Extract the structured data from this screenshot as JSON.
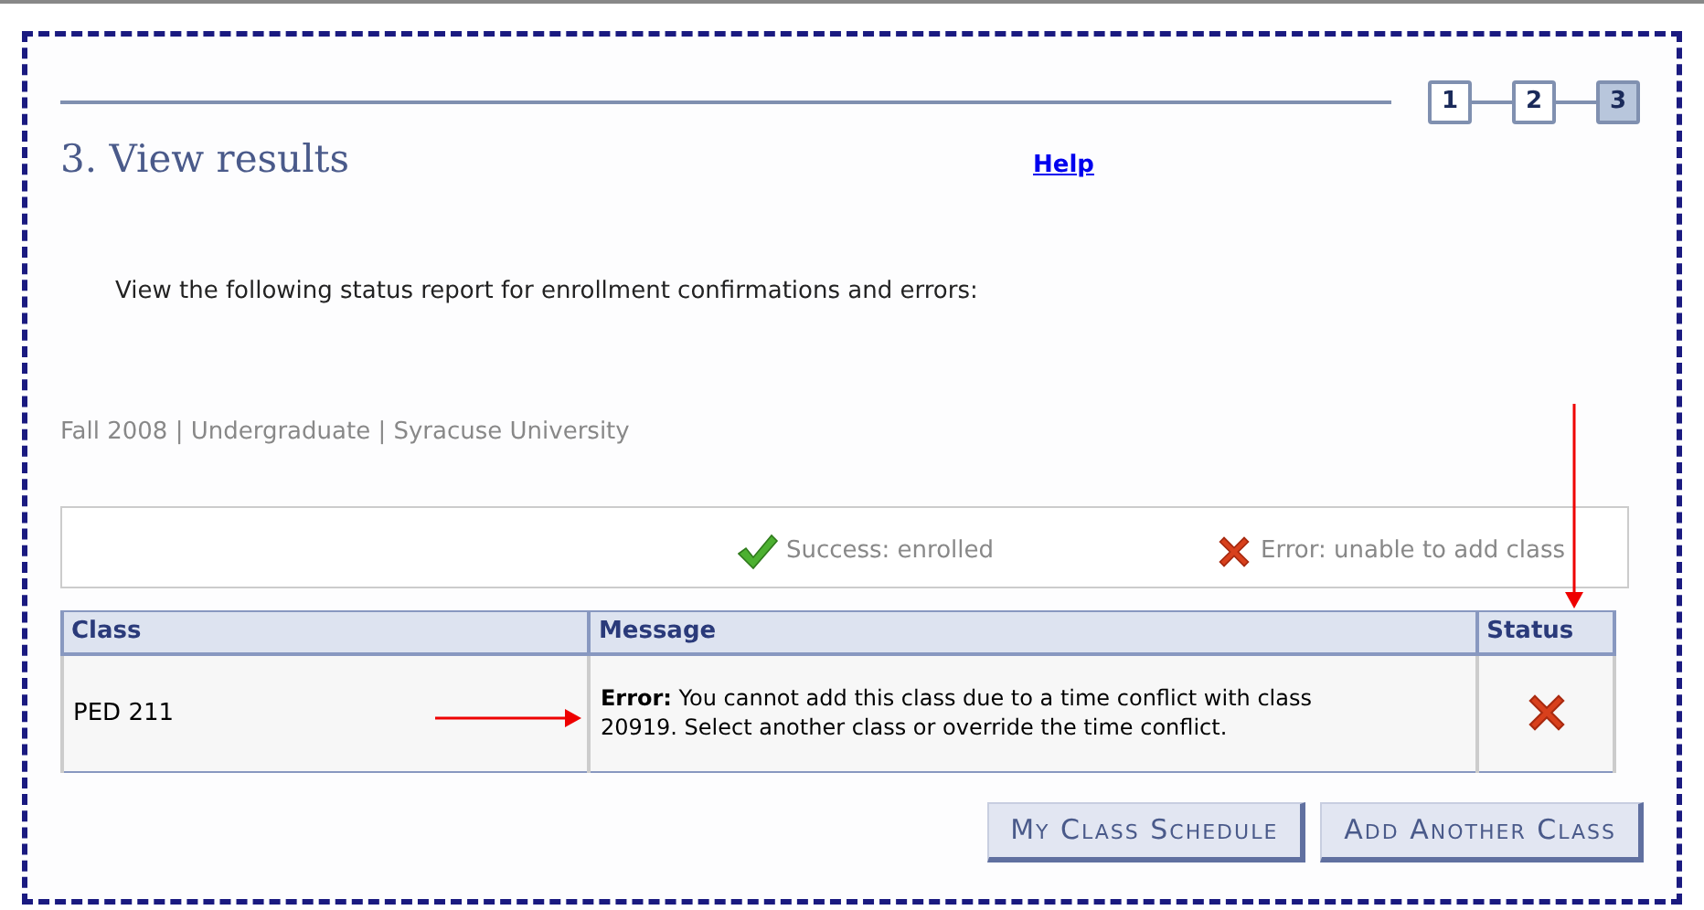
{
  "steps": [
    {
      "label": "1",
      "selected": false
    },
    {
      "label": "2",
      "selected": false
    },
    {
      "label": "3",
      "selected": true
    }
  ],
  "title": "3.  View results",
  "help_link": "Help",
  "instructions": "View the following status report for enrollment confirmations and errors:",
  "term_info": "Fall 2008 | Undergraduate | Syracuse University",
  "legend": [
    {
      "kind": "success",
      "label": "Success: enrolled"
    },
    {
      "kind": "error",
      "label": "Error: unable to add class"
    }
  ],
  "table": {
    "columns": [
      "Class",
      "Message",
      "Status"
    ],
    "rows": [
      {
        "class": "PED 211",
        "message": "**Error:** You cannot add this class due to a time conflict with class 20919. Select another class or override the time conflict.",
        "kind": "error"
      }
    ]
  },
  "buttons": [
    "My Class Schedule",
    "Add Another Class"
  ]
}
